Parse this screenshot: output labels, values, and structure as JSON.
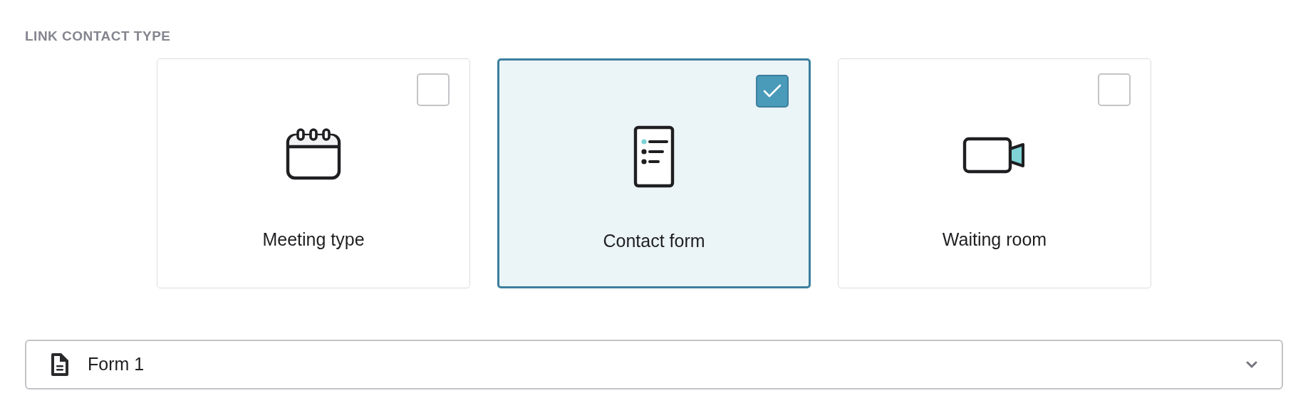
{
  "section_label": "LINK CONTACT TYPE",
  "options": [
    {
      "kind": "calendar",
      "label": "Meeting type",
      "selected": false
    },
    {
      "kind": "form",
      "label": "Contact form",
      "selected": true
    },
    {
      "kind": "video",
      "label": "Waiting room",
      "selected": false
    }
  ],
  "form_select": {
    "value": "Form 1"
  }
}
